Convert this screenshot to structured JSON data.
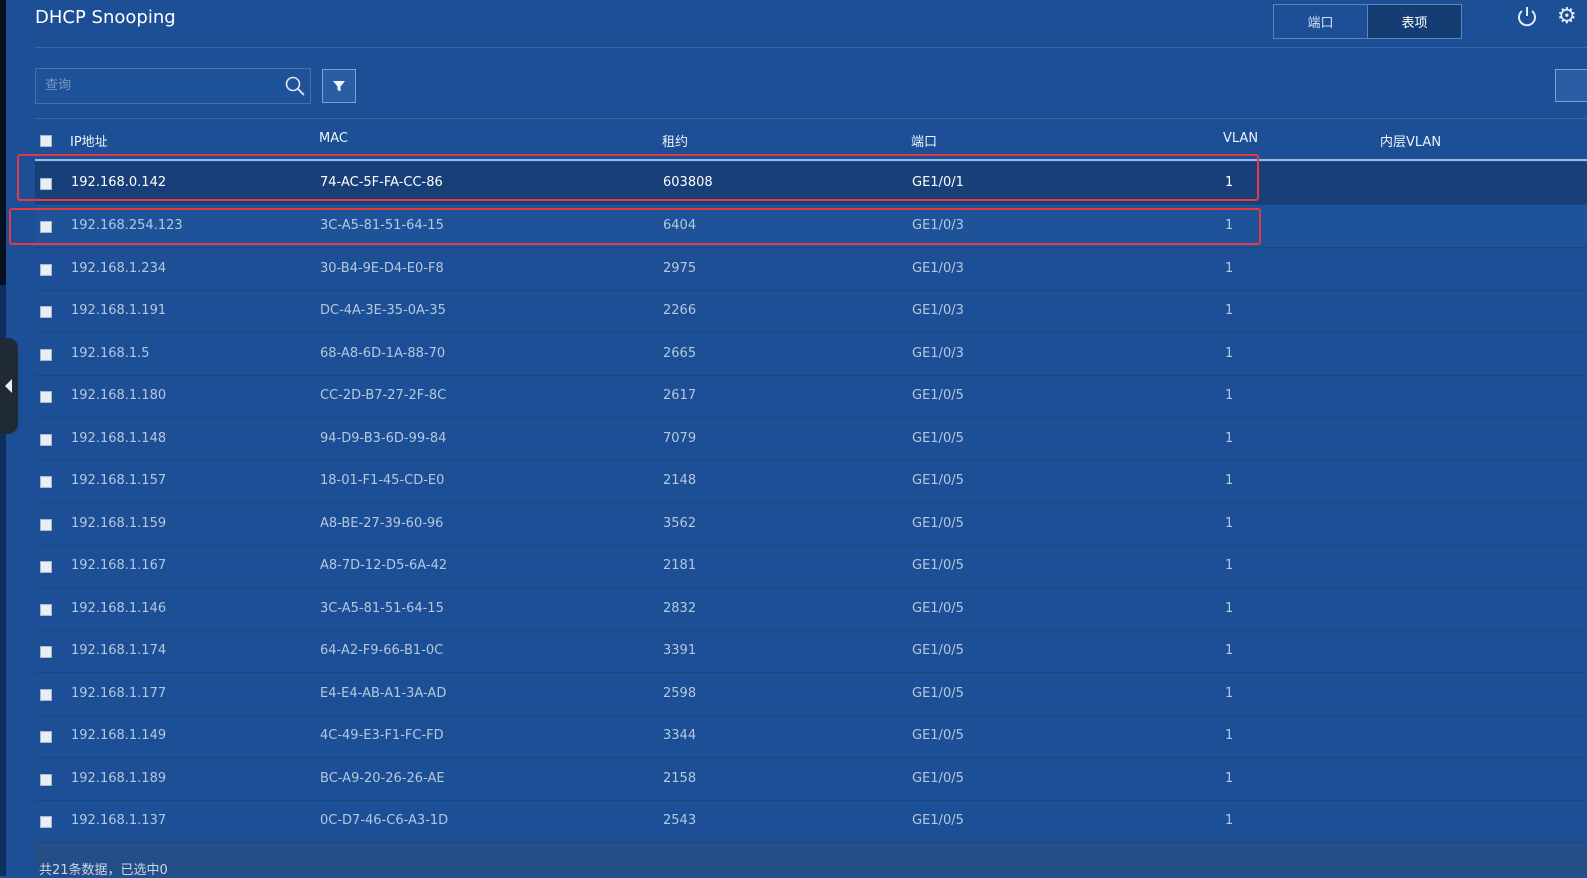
{
  "page_title": "DHCP Snooping",
  "tabs": [
    {
      "label": "端口",
      "active": false
    },
    {
      "label": "表项",
      "active": true
    }
  ],
  "search": {
    "placeholder": "查询"
  },
  "columns": {
    "ip": "IP地址",
    "mac": "MAC",
    "lease": "租约",
    "port": "端口",
    "vlan": "VLAN",
    "inner_vlan": "内层VLAN"
  },
  "rows": [
    {
      "ip": "192.168.0.142",
      "mac": "74-AC-5F-FA-CC-86",
      "lease": "603808",
      "port": "GE1/0/1",
      "vlan": "1",
      "inner_vlan": ""
    },
    {
      "ip": "192.168.254.123",
      "mac": "3C-A5-81-51-64-15",
      "lease": "6404",
      "port": "GE1/0/3",
      "vlan": "1",
      "inner_vlan": ""
    },
    {
      "ip": "192.168.1.234",
      "mac": "30-B4-9E-D4-E0-F8",
      "lease": "2975",
      "port": "GE1/0/3",
      "vlan": "1",
      "inner_vlan": ""
    },
    {
      "ip": "192.168.1.191",
      "mac": "DC-4A-3E-35-0A-35",
      "lease": "2266",
      "port": "GE1/0/3",
      "vlan": "1",
      "inner_vlan": ""
    },
    {
      "ip": "192.168.1.5",
      "mac": "68-A8-6D-1A-88-70",
      "lease": "2665",
      "port": "GE1/0/3",
      "vlan": "1",
      "inner_vlan": ""
    },
    {
      "ip": "192.168.1.180",
      "mac": "CC-2D-B7-27-2F-8C",
      "lease": "2617",
      "port": "GE1/0/5",
      "vlan": "1",
      "inner_vlan": ""
    },
    {
      "ip": "192.168.1.148",
      "mac": "94-D9-B3-6D-99-84",
      "lease": "7079",
      "port": "GE1/0/5",
      "vlan": "1",
      "inner_vlan": ""
    },
    {
      "ip": "192.168.1.157",
      "mac": "18-01-F1-45-CD-E0",
      "lease": "2148",
      "port": "GE1/0/5",
      "vlan": "1",
      "inner_vlan": ""
    },
    {
      "ip": "192.168.1.159",
      "mac": "A8-BE-27-39-60-96",
      "lease": "3562",
      "port": "GE1/0/5",
      "vlan": "1",
      "inner_vlan": ""
    },
    {
      "ip": "192.168.1.167",
      "mac": "A8-7D-12-D5-6A-42",
      "lease": "2181",
      "port": "GE1/0/5",
      "vlan": "1",
      "inner_vlan": ""
    },
    {
      "ip": "192.168.1.146",
      "mac": "3C-A5-81-51-64-15",
      "lease": "2832",
      "port": "GE1/0/5",
      "vlan": "1",
      "inner_vlan": ""
    },
    {
      "ip": "192.168.1.174",
      "mac": "64-A2-F9-66-B1-0C",
      "lease": "3391",
      "port": "GE1/0/5",
      "vlan": "1",
      "inner_vlan": ""
    },
    {
      "ip": "192.168.1.177",
      "mac": "E4-E4-AB-A1-3A-AD",
      "lease": "2598",
      "port": "GE1/0/5",
      "vlan": "1",
      "inner_vlan": ""
    },
    {
      "ip": "192.168.1.149",
      "mac": "4C-49-E3-F1-FC-FD",
      "lease": "3344",
      "port": "GE1/0/5",
      "vlan": "1",
      "inner_vlan": ""
    },
    {
      "ip": "192.168.1.189",
      "mac": "BC-A9-20-26-26-AE",
      "lease": "2158",
      "port": "GE1/0/5",
      "vlan": "1",
      "inner_vlan": ""
    },
    {
      "ip": "192.168.1.137",
      "mac": "0C-D7-46-C6-A3-1D",
      "lease": "2543",
      "port": "GE1/0/5",
      "vlan": "1",
      "inner_vlan": ""
    }
  ],
  "footer": {
    "summary": "共21条数据，已选中0"
  },
  "colors": {
    "background": "#1c4f95",
    "highlight": "#e23b44",
    "selected_row": "#193f78"
  },
  "icons": [
    "search-icon",
    "filter-icon",
    "power-icon",
    "gear-icon",
    "collapse-arrow-icon"
  ]
}
